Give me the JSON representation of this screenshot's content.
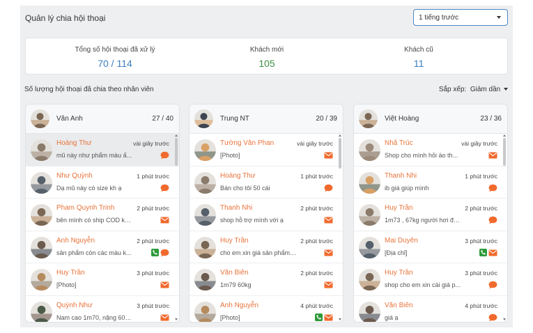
{
  "header": {
    "title": "Quản lý chia hội thoại",
    "time_filter": "1 tiếng trước"
  },
  "stats": [
    {
      "label": "Tổng số hội thoại đã xử lý",
      "value": "70 / 114",
      "color": "#3a7fc0"
    },
    {
      "label": "Khách mới",
      "value": "105",
      "color": "#3d9142"
    },
    {
      "label": "Khách cũ",
      "value": "11",
      "color": "#3a7fc0"
    }
  ],
  "section": {
    "title": "Số lượng hội thoại đã chia theo nhân viên",
    "sort_label": "Sắp xếp:",
    "sort_value": "Giảm dần"
  },
  "colors": {
    "name": "#e8733a",
    "accent_blue": "#3a7fc0",
    "accent_green": "#3d9142",
    "icon_orange": "#f06a2e",
    "icon_green": "#2f9a3a"
  },
  "columns": [
    {
      "agent": "Vân Anh",
      "count": "27 / 40",
      "conversations": [
        {
          "name": "Hoàng Thư",
          "time": "vài giây trước",
          "message": "mũ này như phẩm màu ấ...",
          "icons": [
            "chat"
          ],
          "active": true
        },
        {
          "name": "Như Quỳnh",
          "time": "1 phút trước",
          "message": "Dạ mũ này có size kh ạ",
          "icons": [
            "chat"
          ]
        },
        {
          "name": "Pham Quynh Trinh",
          "time": "2 phút trước",
          "message": "bên mình có ship COD kh...",
          "icons": [
            "mail"
          ]
        },
        {
          "name": "Anh Nguyễn",
          "time": "2 phút trước",
          "message": "sản phẩm còn các màu k...",
          "icons": [
            "phone",
            "chat"
          ]
        },
        {
          "name": "Huy Trần",
          "time": "3 phút trước",
          "message": "[Photo]",
          "icons": [
            "mail"
          ]
        },
        {
          "name": "Quỳnh Như",
          "time": "3 phút trước",
          "message": "Nam cao 1m70, nặng 60k...",
          "icons": [
            "mail"
          ]
        }
      ]
    },
    {
      "agent": "Trung NT",
      "count": "20 / 39",
      "conversations": [
        {
          "name": "Tường Văn Phan",
          "time": "vài giây trước",
          "message": "[Photo]",
          "icons": [
            "mail"
          ]
        },
        {
          "name": "Hoàng Thư",
          "time": "1 phút trước",
          "message": "Bán cho tôi 50 cái",
          "icons": [
            "chat"
          ]
        },
        {
          "name": "Thanh Nhi",
          "time": "2 phút trước",
          "message": "shop hỗ trợ mình với ạ",
          "icons": [
            "mail"
          ]
        },
        {
          "name": "Huy Trần",
          "time": "2 phút trước",
          "message": "cho em xin giá sản phẩm ...",
          "icons": [
            "mail"
          ]
        },
        {
          "name": "Văn Biên",
          "time": "2 phút trước",
          "message": "1m79 60kg",
          "icons": [
            "mail"
          ]
        },
        {
          "name": "Anh Nguyễn",
          "time": "4 phút trước",
          "message": "[Photo]",
          "icons": [
            "phone",
            "mail"
          ]
        }
      ]
    },
    {
      "agent": "Việt Hoàng",
      "count": "23 / 36",
      "conversations": [
        {
          "name": "Nhã Trúc",
          "time": "vài giây trước",
          "message": "Shop cho mình hỏi áo th...",
          "icons": [
            "mail"
          ]
        },
        {
          "name": "Thanh Nhi",
          "time": "1 phút trước",
          "message": "ib giá giúp mình",
          "icons": [
            "chat"
          ]
        },
        {
          "name": "Huy Trần",
          "time": "2 phút trước",
          "message": "1m73 , 67kg người hơi đô...",
          "icons": [
            "chat"
          ]
        },
        {
          "name": "Mai Duyên",
          "time": "3 phút trước",
          "message": "[Địa chỉ]",
          "icons": [
            "phone",
            "mail"
          ]
        },
        {
          "name": "Huy Trần",
          "time": "3 phút trước",
          "message": "shop cho em xin cái giá p...",
          "icons": [
            "chat"
          ]
        },
        {
          "name": "Văn Biên",
          "time": "4 phút trước",
          "message": "giá ạ",
          "icons": [
            "chat"
          ]
        }
      ]
    }
  ]
}
